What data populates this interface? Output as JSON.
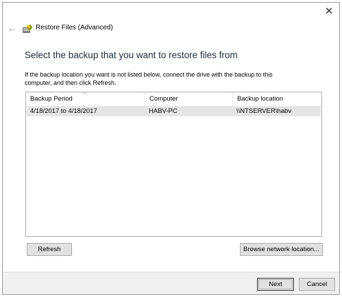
{
  "window": {
    "title": "Restore Files (Advanced)",
    "close_icon": "close-icon",
    "back_icon": "back-arrow-icon"
  },
  "main": {
    "heading": "Select the backup that you want to restore files from",
    "instructions": "If the backup location you want is not listed below, connect the drive with the backup to this computer, and then click Refresh."
  },
  "table": {
    "columns": [
      "Backup Period",
      "Computer",
      "Backup location"
    ],
    "rows": [
      {
        "period": "4/18/2017 to 4/18/2017",
        "computer": "HABV-PC",
        "location": "\\\\NTSERVER\\habv"
      }
    ]
  },
  "buttons": {
    "refresh": "Refresh",
    "browse": "Browse network location...",
    "next": "Next",
    "cancel": "Cancel"
  },
  "colors": {
    "selected_row": "#e5e5e5",
    "footer": "#f0f0f0",
    "button_face": "#e1e1e1"
  }
}
